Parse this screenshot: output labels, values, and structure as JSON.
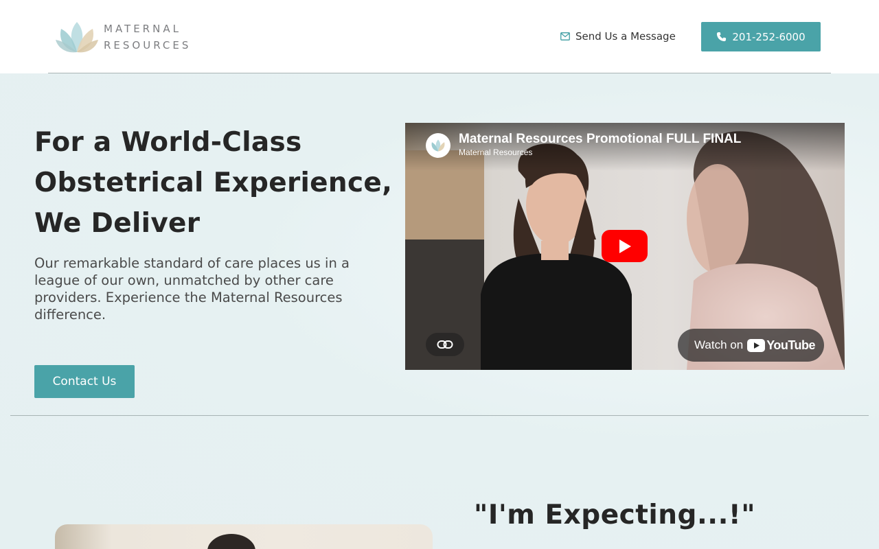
{
  "brand": {
    "line1": "MATERNAL",
    "line2": "RESOURCES",
    "logo_icon": "lotus-icon",
    "accent_color": "#4aa3a8"
  },
  "header": {
    "message_label": "Send Us a Message",
    "message_icon": "envelope-icon",
    "phone_label": "201-252-6000",
    "phone_icon": "phone-icon"
  },
  "hero": {
    "title": "For a World-Class Obstetrical Experience, We Deliver",
    "text": "Our remarkable standard of care places us in a league of our own, unmatched by other care providers. Experience the Maternal Resources difference.",
    "contact_label": "Contact Us"
  },
  "video": {
    "title": "Maternal Resources Promotional FULL FINAL",
    "channel": "Maternal Resources",
    "watch_label": "Watch on",
    "platform": "YouTube",
    "play_icon": "play-icon",
    "link_icon": "link-icon"
  },
  "next_section": {
    "heading": "\"I'm Expecting...!\""
  }
}
